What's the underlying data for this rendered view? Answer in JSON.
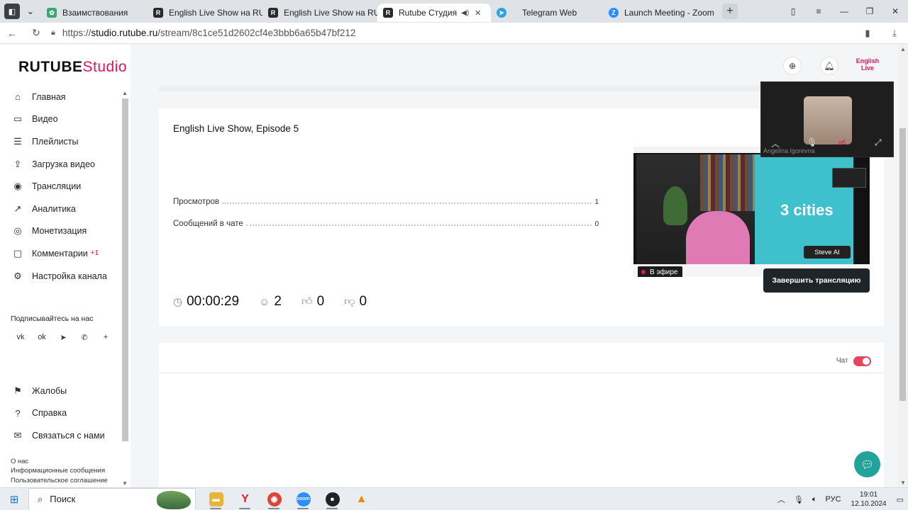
{
  "browser": {
    "tabs": [
      {
        "label": "Взаимствования",
        "icon": "grass-icon",
        "color": "#3aa76d"
      },
      {
        "label": "English Live Show на RUTUBE",
        "icon": "rutube-icon",
        "color": "#2a2a2a"
      },
      {
        "label": "English Live Show на RUTUBE",
        "icon": "rutube-icon",
        "color": "#2a2a2a"
      },
      {
        "label": "Rutube Студия",
        "icon": "rutube-icon",
        "color": "#2a2a2a",
        "active": true
      },
      {
        "label": "Telegram Web",
        "icon": "telegram-icon",
        "color": "#2aa3e0"
      },
      {
        "label": "Launch Meeting - Zoom",
        "icon": "zoom-icon",
        "color": "#2d8cff"
      }
    ],
    "tab_partials": [
      "Взаимствования",
      "English Live Show на RU",
      "English Live Show на RU",
      "Rutube Студия",
      "Telegram Web",
      "Launch Meeting - Zoom"
    ],
    "url_prefix": "https://",
    "url_host": "studio.rutube.ru",
    "url_path": "/stream/8c1ce51d2602cf4e3bbb6a65b47bf212"
  },
  "sidebar": {
    "logo_part1": "RUTUBE",
    "logo_part2": "Studio",
    "menu": [
      {
        "label": "Главная",
        "icon": "home-icon"
      },
      {
        "label": "Видео",
        "icon": "video-icon"
      },
      {
        "label": "Плейлисты",
        "icon": "playlist-icon"
      },
      {
        "label": "Загрузка видео",
        "icon": "upload-icon"
      },
      {
        "label": "Трансляции",
        "icon": "broadcast-icon"
      },
      {
        "label": "Аналитика",
        "icon": "analytics-icon"
      },
      {
        "label": "Монетизация",
        "icon": "money-icon"
      },
      {
        "label": "Комментарии",
        "icon": "comment-icon",
        "badge": "+1"
      },
      {
        "label": "Настройка канала",
        "icon": "settings-icon"
      }
    ],
    "subscribe_label": "Подписывайтесь на нас",
    "socials": [
      "vk-icon",
      "ok-icon",
      "telegram-icon",
      "viber-icon",
      "plus-icon"
    ],
    "menu2": [
      {
        "label": "Жалобы",
        "icon": "flag-icon"
      },
      {
        "label": "Справка",
        "icon": "help-icon"
      },
      {
        "label": "Связаться с нами",
        "icon": "mail-icon"
      }
    ],
    "footer_links": [
      "О нас",
      "Информационные сообщения",
      "Пользовательское соглашение"
    ]
  },
  "stream": {
    "title": "English Live Show, Episode 5",
    "stats": [
      {
        "label": "Просмотров",
        "value": "1"
      },
      {
        "label": "Сообщений в чате",
        "value": "0"
      }
    ],
    "metrics": {
      "duration": "00:00:29",
      "viewers": "2",
      "likes": "0",
      "dislikes": "0"
    },
    "live_label": "В эфире",
    "preview_text": "3 cities",
    "preview_brand": "Steve AI",
    "end_button": "Завершить трансляцию"
  },
  "chat": {
    "label": "Чат",
    "enabled": true
  },
  "header": {
    "channel_avatar_text": "English Live"
  },
  "zoom": {
    "participant_name": "Angelina Igorevna"
  },
  "taskbar": {
    "search_placeholder": "Поиск",
    "lang": "РУС",
    "time": "19:01",
    "date": "12.10.2024"
  },
  "colors": {
    "brand": "#e0145a",
    "end_button_bg": "#1f2429",
    "help_fab": "#21a39b"
  }
}
